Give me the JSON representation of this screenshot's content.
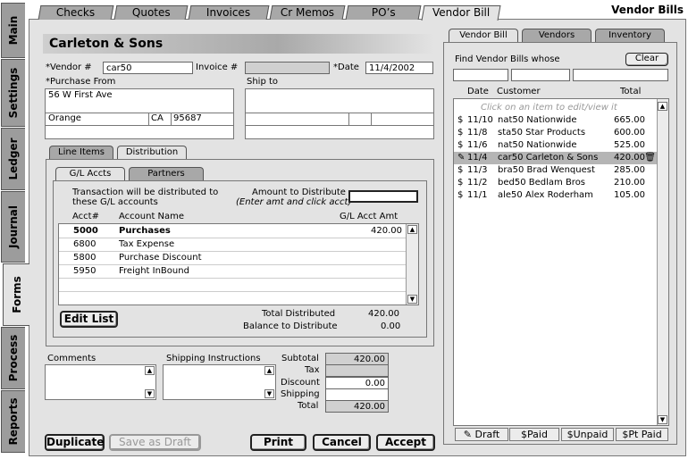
{
  "app_title": "Vendor Bills",
  "top_tabs": [
    "Checks",
    "Quotes",
    "Invoices",
    "Cr Memos",
    "PO’s",
    "Vendor Bill"
  ],
  "side_tabs": [
    "Main",
    "Settings",
    "Ledger",
    "Journal",
    "Forms",
    "Process",
    "Reports"
  ],
  "header": {
    "vendor_name": "Carleton & Sons"
  },
  "fields": {
    "vendor_label": "*Vendor #",
    "vendor_value": "car50",
    "invoice_label": "Invoice #",
    "invoice_value": "",
    "date_label": "*Date",
    "date_value": "11/4/2002",
    "purchase_from_label": "*Purchase From",
    "ship_to_label": "Ship to",
    "address_line1": "56 W First Ave",
    "city": "Orange",
    "state": "CA",
    "zip": "95687"
  },
  "detail_tabs": [
    "Line Items",
    "Distribution"
  ],
  "dist_tabs": [
    "G/L Accts",
    "Partners"
  ],
  "distribution": {
    "note": "Transaction will be distributed to these G/L accounts",
    "amount_label": "Amount to Distribute",
    "amount_hint": "(Enter amt and click acct)",
    "col_acct": "Acct#",
    "col_name": "Account Name",
    "col_amt": "G/L Acct Amt",
    "rows": [
      {
        "acct": "5000",
        "name": "Purchases",
        "amt": "420.00"
      },
      {
        "acct": "6800",
        "name": "Tax Expense",
        "amt": ""
      },
      {
        "acct": "5800",
        "name": "Purchase Discount",
        "amt": ""
      },
      {
        "acct": "5950",
        "name": "Freight InBound",
        "amt": ""
      }
    ],
    "edit_list": "Edit List",
    "total_distributed_label": "Total Distributed",
    "total_distributed": "420.00",
    "balance_label": "Balance to Distribute",
    "balance": "0.00"
  },
  "comments_label": "Comments",
  "shipping_label": "Shipping Instructions",
  "totals": {
    "subtotal_label": "Subtotal",
    "subtotal": "420.00",
    "tax_label": "Tax",
    "tax": "",
    "discount_label": "Discount",
    "discount": "0.00",
    "shipping_label": "Shipping",
    "shipping": "",
    "total_label": "Total",
    "total": "420.00"
  },
  "buttons": {
    "duplicate": "Duplicate",
    "save_draft": "Save as Draft",
    "print": "Print",
    "cancel": "Cancel",
    "accept": "Accept"
  },
  "right_tabs": [
    "Vendor Bill",
    "Vendors",
    "Inventory"
  ],
  "finder": {
    "label": "Find Vendor Bills whose",
    "clear": "Clear",
    "col_date": "Date",
    "col_customer": "Customer",
    "col_total": "Total",
    "hint": "Click on an item to edit/view it",
    "rows": [
      {
        "icon": "$",
        "date": "11/10",
        "customer": "nat50 Nationwide",
        "total": "665.00"
      },
      {
        "icon": "$",
        "date": "11/8",
        "customer": "sta50 Star Products",
        "total": "600.00"
      },
      {
        "icon": "$",
        "date": "11/6",
        "customer": "nat50 Nationwide",
        "total": "525.00"
      },
      {
        "icon": "✎",
        "date": "11/4",
        "customer": "car50 Carleton & Sons",
        "total": "420.00"
      },
      {
        "icon": "$",
        "date": "11/3",
        "customer": "bra50 Brad Wenquest",
        "total": "285.00"
      },
      {
        "icon": "$",
        "date": "11/2",
        "customer": "bed50 Bedlam Bros",
        "total": "210.00"
      },
      {
        "icon": "$",
        "date": "11/1",
        "customer": "ale50 Alex Roderham",
        "total": "105.00"
      }
    ],
    "filters": [
      "Draft",
      "Paid",
      "Unpaid",
      "Pt Paid"
    ]
  }
}
